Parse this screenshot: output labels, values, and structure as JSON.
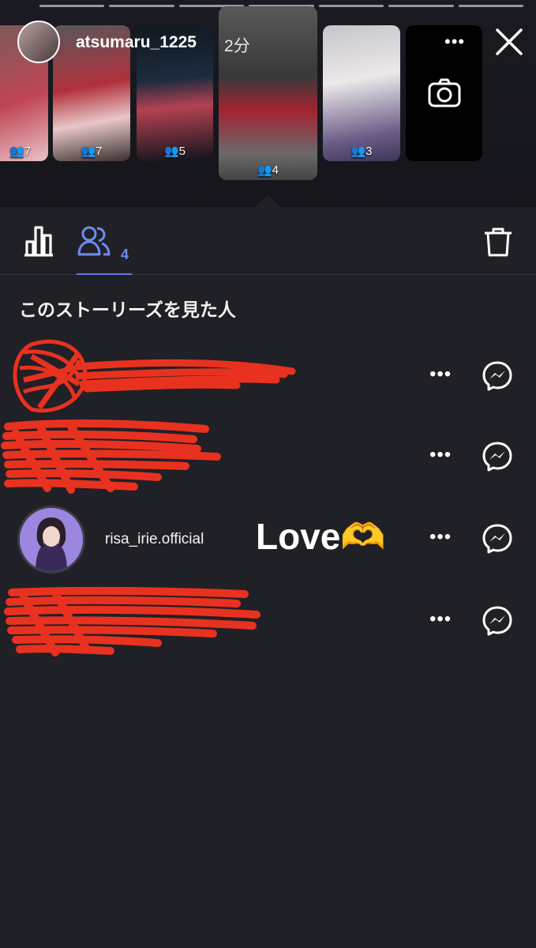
{
  "header": {
    "username": "atsumaru_1225",
    "time": "2分",
    "more_icon": "more-horizontal-icon",
    "close_icon": "close-icon"
  },
  "stories": [
    {
      "count": "7"
    },
    {
      "count": "7"
    },
    {
      "count": "5"
    },
    {
      "count": "4",
      "selected": true
    },
    {
      "count": "3"
    },
    {
      "camera": true
    }
  ],
  "tabs": {
    "insights_icon": "bar-chart-icon",
    "viewers_icon": "viewers-icon",
    "viewers_count": "4",
    "delete_icon": "trash-icon"
  },
  "section_title": "このストーリーズを見た人",
  "viewers": [
    {
      "username": "",
      "redacted": true
    },
    {
      "username": "",
      "redacted": true
    },
    {
      "username": "risa_irie.official",
      "reaction": "Love🫶"
    },
    {
      "username": "",
      "redacted": true
    }
  ],
  "colors": {
    "background": "#202027",
    "accent": "#6f8bf0",
    "redaction": "#e8321f"
  }
}
